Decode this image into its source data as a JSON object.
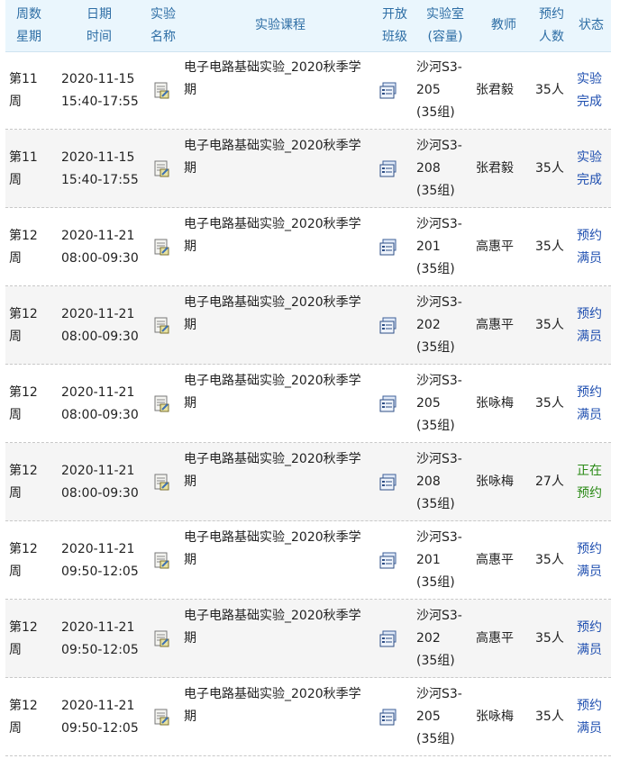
{
  "header": {
    "week": [
      "周数",
      "星期"
    ],
    "datetime": [
      "日期",
      "时间"
    ],
    "expname": [
      "实验",
      "名称"
    ],
    "course": "实验课程",
    "openclass": [
      "开放",
      "班级"
    ],
    "room": [
      "实验室",
      "(容量)"
    ],
    "teacher": "教师",
    "booked": [
      "预约",
      "人数"
    ],
    "status": "状态"
  },
  "rows": [
    {
      "week": [
        "第11",
        "周"
      ],
      "date": "2020-11-15",
      "time": "15:40-17:55",
      "course": [
        "电子电路基础实验_2020秋季学",
        "期"
      ],
      "room": [
        "沙河S3-",
        "205",
        "(35组)"
      ],
      "teacher": "张君毅",
      "booked": "35人",
      "status": [
        "实验",
        "完成"
      ],
      "status_color": "blue"
    },
    {
      "week": [
        "第11",
        "周"
      ],
      "date": "2020-11-15",
      "time": "15:40-17:55",
      "course": [
        "电子电路基础实验_2020秋季学",
        "期"
      ],
      "room": [
        "沙河S3-",
        "208",
        "(35组)"
      ],
      "teacher": "张君毅",
      "booked": "35人",
      "status": [
        "实验",
        "完成"
      ],
      "status_color": "blue"
    },
    {
      "week": [
        "第12",
        "周"
      ],
      "date": "2020-11-21",
      "time": "08:00-09:30",
      "course": [
        "电子电路基础实验_2020秋季学",
        "期"
      ],
      "room": [
        "沙河S3-",
        "201",
        "(35组)"
      ],
      "teacher": "高惠平",
      "booked": "35人",
      "status": [
        "预约",
        "满员"
      ],
      "status_color": "blue"
    },
    {
      "week": [
        "第12",
        "周"
      ],
      "date": "2020-11-21",
      "time": "08:00-09:30",
      "course": [
        "电子电路基础实验_2020秋季学",
        "期"
      ],
      "room": [
        "沙河S3-",
        "202",
        "(35组)"
      ],
      "teacher": "高惠平",
      "booked": "35人",
      "status": [
        "预约",
        "满员"
      ],
      "status_color": "blue"
    },
    {
      "week": [
        "第12",
        "周"
      ],
      "date": "2020-11-21",
      "time": "08:00-09:30",
      "course": [
        "电子电路基础实验_2020秋季学",
        "期"
      ],
      "room": [
        "沙河S3-",
        "205",
        "(35组)"
      ],
      "teacher": "张咏梅",
      "booked": "35人",
      "status": [
        "预约",
        "满员"
      ],
      "status_color": "blue"
    },
    {
      "week": [
        "第12",
        "周"
      ],
      "date": "2020-11-21",
      "time": "08:00-09:30",
      "course": [
        "电子电路基础实验_2020秋季学",
        "期"
      ],
      "room": [
        "沙河S3-",
        "208",
        "(35组)"
      ],
      "teacher": "张咏梅",
      "booked": "27人",
      "status": [
        "正在",
        "预约"
      ],
      "status_color": "green"
    },
    {
      "week": [
        "第12",
        "周"
      ],
      "date": "2020-11-21",
      "time": "09:50-12:05",
      "course": [
        "电子电路基础实验_2020秋季学",
        "期"
      ],
      "room": [
        "沙河S3-",
        "201",
        "(35组)"
      ],
      "teacher": "高惠平",
      "booked": "35人",
      "status": [
        "预约",
        "满员"
      ],
      "status_color": "blue"
    },
    {
      "week": [
        "第12",
        "周"
      ],
      "date": "2020-11-21",
      "time": "09:50-12:05",
      "course": [
        "电子电路基础实验_2020秋季学",
        "期"
      ],
      "room": [
        "沙河S3-",
        "202",
        "(35组)"
      ],
      "teacher": "高惠平",
      "booked": "35人",
      "status": [
        "预约",
        "满员"
      ],
      "status_color": "blue"
    },
    {
      "week": [
        "第12",
        "周"
      ],
      "date": "2020-11-21",
      "time": "09:50-12:05",
      "course": [
        "电子电路基础实验_2020秋季学",
        "期"
      ],
      "room": [
        "沙河S3-",
        "205",
        "(35组)"
      ],
      "teacher": "张咏梅",
      "booked": "35人",
      "status": [
        "预约",
        "满员"
      ],
      "status_color": "blue"
    }
  ],
  "colors": {
    "header_bg": "#eaf6fd",
    "header_text": "#2e6ea5",
    "status_blue": "#1f4fb0",
    "status_green": "#2a8a16"
  },
  "icons": {
    "exp_name": "document-edit-icon",
    "open_class": "class-list-icon"
  }
}
